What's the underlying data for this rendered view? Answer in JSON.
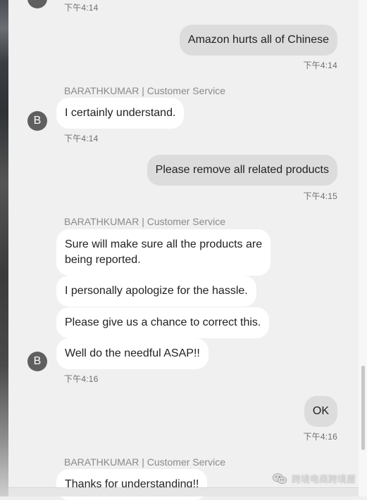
{
  "colors": {
    "chat_bg": "#f0f0f0",
    "incoming_bubble": "#ffffff",
    "outgoing_bubble": "#dcdcdc",
    "avatar_bg": "#5f5f5f"
  },
  "messages": {
    "ts_top": "下午4:14",
    "out1": {
      "text": "Amazon hurts all of Chinese",
      "time": "下午4:14"
    },
    "group1": {
      "sender": "BARATHKUMAR | Customer Service",
      "avatar_letter": "B",
      "bubble1": "I certainly understand.",
      "time": "下午4:14"
    },
    "out2": {
      "text": "Please remove all related products",
      "time": "下午4:15"
    },
    "group2": {
      "sender": "BARATHKUMAR | Customer Service",
      "avatar_letter": "B",
      "bubble1_line1": "Sure will make sure all the products are",
      "bubble1_line2": "being reported.",
      "bubble2": "I personally apologize for the hassle.",
      "bubble3": "Please give us a chance to correct this.",
      "bubble4": "Well do the needful ASAP!!",
      "time": "下午4:16"
    },
    "out3": {
      "text": "OK",
      "time": "下午4:16"
    },
    "group3": {
      "sender": "BARATHKUMAR | Customer Service",
      "bubble1": "Thanks for understanding!!"
    }
  },
  "watermark": {
    "text": "跨境电商跨境屋",
    "icon": "wechat-icon"
  }
}
